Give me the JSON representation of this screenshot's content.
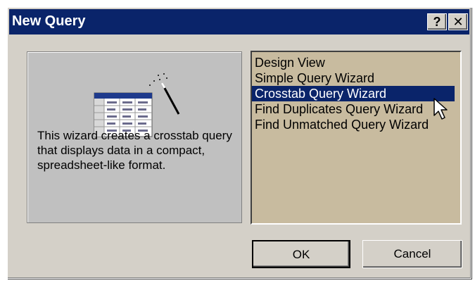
{
  "window": {
    "title": "New Query",
    "help_label": "?",
    "close_label": "✕"
  },
  "description": "This wizard creates a crosstab query that displays data in a compact, spreadsheet-like format.",
  "options": [
    {
      "label": "Design View",
      "selected": false
    },
    {
      "label": "Simple Query Wizard",
      "selected": false
    },
    {
      "label": "Crosstab Query Wizard",
      "selected": true
    },
    {
      "label": "Find Duplicates Query Wizard",
      "selected": false
    },
    {
      "label": "Find Unmatched Query Wizard",
      "selected": false
    }
  ],
  "buttons": {
    "ok": "OK",
    "cancel": "Cancel"
  },
  "colors": {
    "titlebar": "#0a246a",
    "list_bg": "#c8bb9f",
    "selection": "#0a246a",
    "face": "#d4d0c8"
  },
  "icons": {
    "preview": "crosstab-wizard-illustration",
    "pointer": "mouse-cursor-icon"
  }
}
